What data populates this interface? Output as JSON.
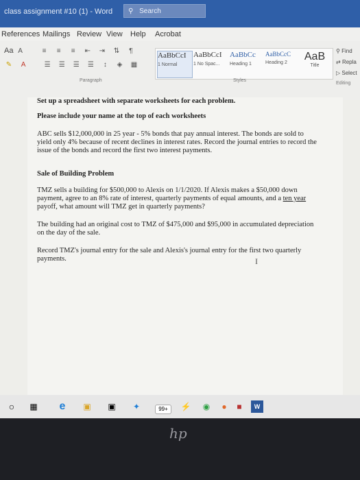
{
  "window": {
    "title": "class assignment #10 (1) - Word",
    "search_placeholder": "Search"
  },
  "menu": [
    "References",
    "Mailings",
    "Review",
    "View",
    "Help",
    "Acrobat"
  ],
  "ribbon": {
    "font_size_label": "Aa",
    "styles": [
      {
        "sample": "AaBbCcI",
        "label": "1 Normal"
      },
      {
        "sample": "AaBbCcI",
        "label": "1 No Spac..."
      },
      {
        "sample": "AaBbCc",
        "label": "Heading 1"
      },
      {
        "sample": "AaBbCcC",
        "label": "Heading 2"
      },
      {
        "sample": "AaB",
        "label": "Title"
      }
    ],
    "paragraph_label": "Paragraph",
    "styles_label": "Styles",
    "editing_label": "Editing",
    "find_label": "Find",
    "replace_label": "Repla",
    "select_label": "Select"
  },
  "document": {
    "heading": "Set up a spreadsheet with separate worksheets for each problem.",
    "instruction": "Please include your name at the top of each worksheets",
    "p1_line1": "ABC sells $12,000,000 in 25 year - 5% bonds that pay annual interest. The bonds are sold to",
    "p1_line2": "yield only 4% because of recent declines in interest rates. Record the journal entries to record the",
    "p1_line3": "issue of the bonds and record the first two interest payments.",
    "sale_heading": "Sale of Building Problem",
    "p2_line1": "TMZ sells a building for $500,000 to Alexis on 1/1/2020. If Alexis makes a $50,000 down",
    "p2_line2": "payment, agree to an 8% rate of interest, quarterly payments of equal amounts, and a ",
    "p2_underlined": "ten year",
    "p2_line3": "payoff, what amount will TMZ get in quarterly payments?",
    "p3_line1": "The building had an original cost to TMZ of $475,000 and $95,000 in accumulated depreciation",
    "p3_line2": "on the day of the sale.",
    "p4_line1": "Record TMZ's journal entry for the sale and Alexis's journal entry for the first two quarterly",
    "p4_line2": "payments."
  },
  "taskbar": {
    "badge": "99+"
  },
  "colors": {
    "titlebar": "#2f5fa8",
    "page": "#f4f4f1"
  }
}
